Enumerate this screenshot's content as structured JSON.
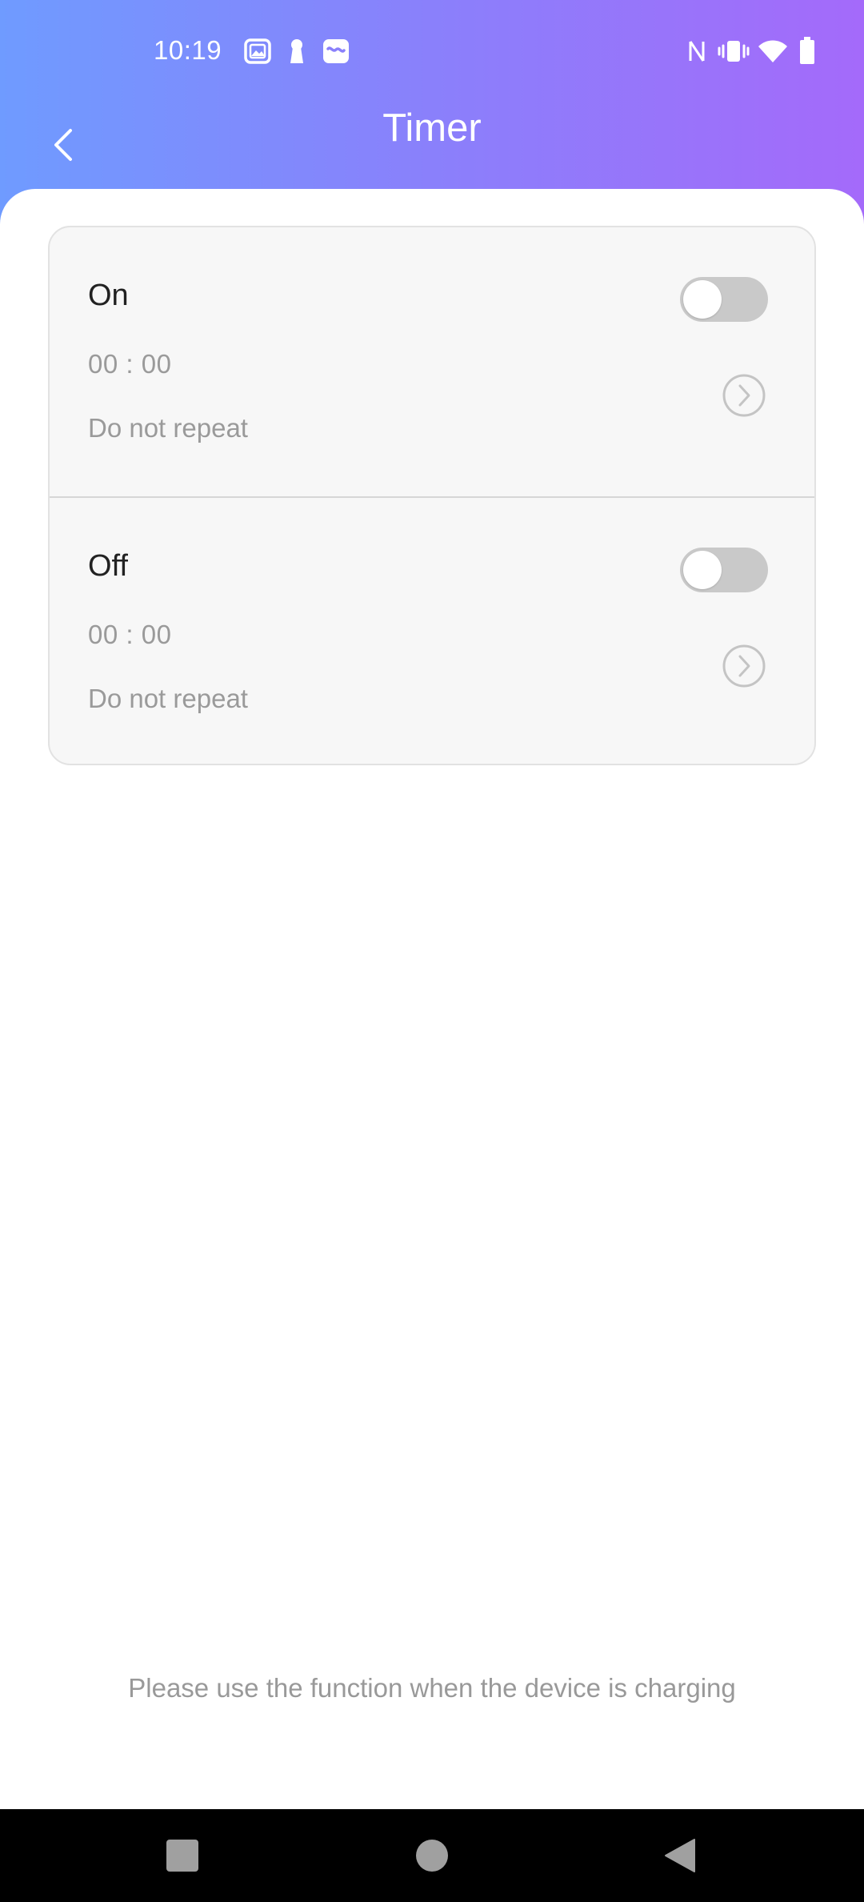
{
  "status_bar": {
    "time": "10:19",
    "left_icons": [
      "gallery-icon",
      "keyhole-icon",
      "app-notification-icon"
    ],
    "right_icons": [
      "nfc-icon",
      "vibrate-icon",
      "wifi-icon",
      "battery-icon"
    ]
  },
  "header": {
    "title": "Timer",
    "back_icon": "chevron-left-icon",
    "gradient_start": "#6f9bff",
    "gradient_end": "#a46afa"
  },
  "timers": [
    {
      "label": "On",
      "time": "00 : 00",
      "repeat": "Do not repeat",
      "enabled": false
    },
    {
      "label": "Off",
      "time": "00 : 00",
      "repeat": "Do not repeat",
      "enabled": false
    }
  ],
  "footer": {
    "note": "Please use the function when the device is charging"
  },
  "nav_bar": {
    "buttons": [
      "recents-icon",
      "home-icon",
      "back-icon"
    ]
  }
}
